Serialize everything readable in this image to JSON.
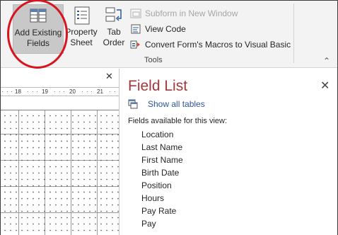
{
  "ribbon": {
    "add_existing_fields": {
      "line1": "Add Existing",
      "line2": "Fields"
    },
    "property_sheet": {
      "line1": "Property",
      "line2": "Sheet"
    },
    "tab_order": {
      "line1": "Tab",
      "line2": "Order"
    },
    "commands": [
      {
        "label": "Subform in New Window",
        "enabled": false,
        "icon": "subform-icon"
      },
      {
        "label": "View Code",
        "enabled": true,
        "icon": "view-code-icon"
      },
      {
        "label": "Convert Form's Macros to Visual Basic",
        "enabled": true,
        "icon": "convert-macros-icon"
      }
    ],
    "group_label": "Tools"
  },
  "design": {
    "ruler_labels": [
      "18",
      "19",
      "20",
      "21"
    ]
  },
  "field_list": {
    "title": "Field List",
    "show_all_tables": "Show all tables",
    "subtitle": "Fields available for this view:",
    "fields": [
      "Location",
      "Last Name",
      "First Name",
      "Birth Date",
      "Position",
      "Hours",
      "Pay Rate",
      "Pay"
    ]
  },
  "colors": {
    "accent_title": "#a4373a",
    "link_blue": "#2b579a",
    "highlight_circle": "#d9141e",
    "selected_button": "#c8c8c8"
  }
}
